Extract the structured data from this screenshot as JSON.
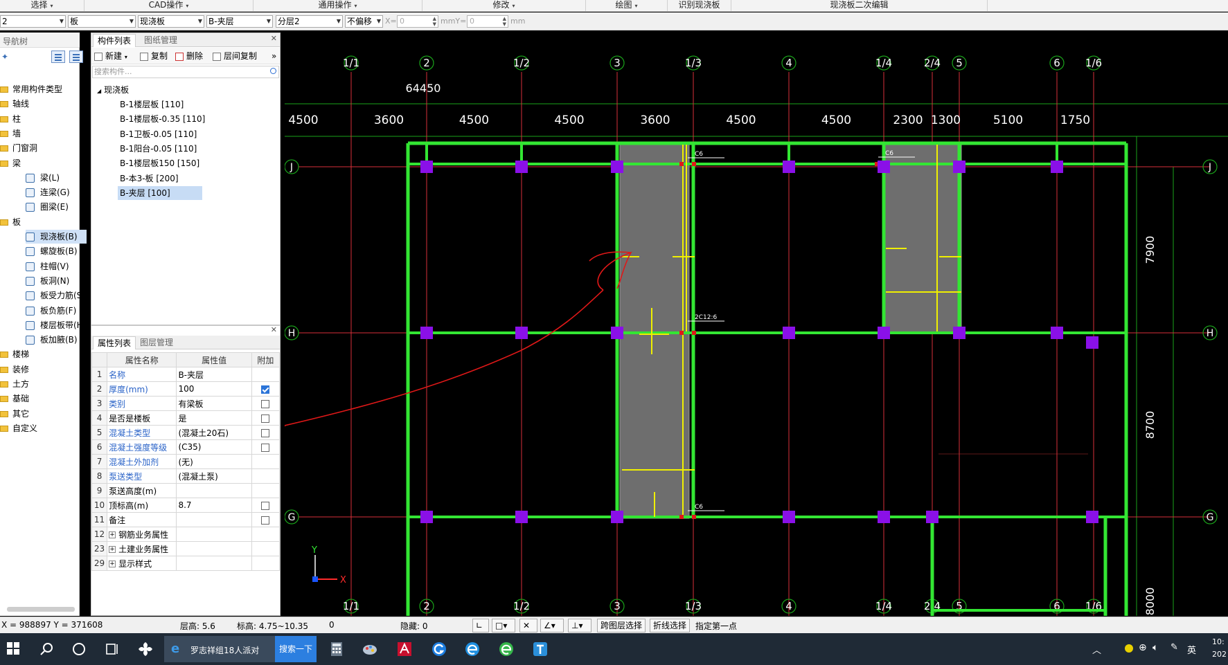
{
  "ribbon": {
    "groups": [
      {
        "label": "选择",
        "arrow": "▾"
      },
      {
        "label": "CAD操作",
        "arrow": "▾"
      },
      {
        "label": "通用操作",
        "arrow": "▾"
      },
      {
        "label": "修改",
        "arrow": "▾"
      },
      {
        "label": "绘图",
        "arrow": "▾"
      },
      {
        "label": "识别现浇板",
        "arrow": ""
      },
      {
        "label": "现浇板二次编辑",
        "arrow": ""
      }
    ]
  },
  "toolbar": {
    "floor": "2",
    "category": "板",
    "type": "现浇板",
    "component": "B-夹层",
    "layer": "分层2",
    "offset_mode": "不偏移",
    "x_label": "X=",
    "x_value": "0",
    "y_label": "mmY=",
    "y_value": "0",
    "unit": "mm"
  },
  "nav": {
    "title": "导航树",
    "items": [
      {
        "label": "常用构件类型",
        "level": 0
      },
      {
        "label": "轴线",
        "level": 0
      },
      {
        "label": "柱",
        "level": 0
      },
      {
        "label": "墙",
        "level": 0
      },
      {
        "label": "门窗洞",
        "level": 0
      },
      {
        "label": "梁",
        "level": 0
      },
      {
        "label": "梁(L)",
        "level": 1
      },
      {
        "label": "连梁(G)",
        "level": 1
      },
      {
        "label": "圈梁(E)",
        "level": 1
      },
      {
        "label": "板",
        "level": 0
      },
      {
        "label": "现浇板(B)",
        "level": 1,
        "selected": true
      },
      {
        "label": "螺旋板(B)",
        "level": 1
      },
      {
        "label": "柱帽(V)",
        "level": 1
      },
      {
        "label": "板洞(N)",
        "level": 1
      },
      {
        "label": "板受力筋(S)",
        "level": 1
      },
      {
        "label": "板负筋(F)",
        "level": 1
      },
      {
        "label": "楼层板带(H)",
        "level": 1
      },
      {
        "label": "板加腋(B)",
        "level": 1
      },
      {
        "label": "楼梯",
        "level": 0
      },
      {
        "label": "装修",
        "level": 0
      },
      {
        "label": "土方",
        "level": 0
      },
      {
        "label": "基础",
        "level": 0
      },
      {
        "label": "其它",
        "level": 0
      },
      {
        "label": "自定义",
        "level": 0
      }
    ]
  },
  "component_panel": {
    "tabs": [
      "构件列表",
      "图纸管理"
    ],
    "tools": [
      "新建",
      "复制",
      "删除",
      "层间复制"
    ],
    "more": "»",
    "search_placeholder": "搜索构件...",
    "group": "现浇板",
    "items": [
      {
        "label": "B-1楼层板 [110]"
      },
      {
        "label": "B-1楼层板-0.35 [110]"
      },
      {
        "label": "B-1卫板-0.05 [110]"
      },
      {
        "label": "B-1阳台-0.05 [110]"
      },
      {
        "label": "B-1楼层板150 [150]"
      },
      {
        "label": "B-本3-板 [200]"
      },
      {
        "label": "B-夹层 [100]",
        "selected": true
      }
    ]
  },
  "property_panel": {
    "tabs": [
      "属性列表",
      "图层管理"
    ],
    "headers": [
      "属性名称",
      "属性值",
      "附加"
    ],
    "rows": [
      {
        "no": "1",
        "name": "名称",
        "value": "B-夹层",
        "link": true,
        "check": "none"
      },
      {
        "no": "2",
        "name": "厚度(mm)",
        "value": "100",
        "link": true,
        "check": "on"
      },
      {
        "no": "3",
        "name": "类别",
        "value": "有梁板",
        "link": true,
        "check": "off"
      },
      {
        "no": "4",
        "name": "是否是楼板",
        "value": "是",
        "link": false,
        "check": "off"
      },
      {
        "no": "5",
        "name": "混凝土类型",
        "value": "(混凝土20石)",
        "link": true,
        "check": "off"
      },
      {
        "no": "6",
        "name": "混凝土强度等级",
        "value": "(C35)",
        "link": true,
        "check": "off"
      },
      {
        "no": "7",
        "name": "混凝土外加剂",
        "value": "(无)",
        "link": true,
        "check": "none"
      },
      {
        "no": "8",
        "name": "泵送类型",
        "value": "(混凝土泵)",
        "link": true,
        "check": "none"
      },
      {
        "no": "9",
        "name": "泵送高度(m)",
        "value": "",
        "link": false,
        "check": "none"
      },
      {
        "no": "10",
        "name": "顶标高(m)",
        "value": "8.7",
        "link": false,
        "check": "off"
      },
      {
        "no": "11",
        "name": "备注",
        "value": "",
        "link": false,
        "check": "off"
      },
      {
        "no": "12",
        "name": "钢筋业务属性",
        "value": "",
        "link": false,
        "check": "none",
        "expand": true
      },
      {
        "no": "23",
        "name": "土建业务属性",
        "value": "",
        "link": false,
        "check": "none",
        "expand": true
      },
      {
        "no": "29",
        "name": "显示样式",
        "value": "",
        "link": false,
        "check": "none",
        "expand": true
      }
    ]
  },
  "drawing": {
    "axes_x": [
      "1/1",
      "2",
      "1/2",
      "3",
      "1/3",
      "4",
      "1/4",
      "2/4",
      "5",
      "6",
      "1/6"
    ],
    "axes_y": [
      "J",
      "H",
      "G"
    ],
    "total_dim": "64450",
    "dims_x": [
      "4500",
      "3600",
      "4500",
      "4500",
      "3600",
      "4500",
      "4500",
      "2300",
      "1300",
      "5100",
      "1750"
    ],
    "dims_y": [
      "7900",
      "8700",
      "8000"
    ],
    "rebar_labels": [
      "C6",
      "C6",
      "2C12:6",
      "C6"
    ],
    "ucs_x": "X",
    "ucs_y": "Y",
    "colors": {
      "beam": "#33e633",
      "column": "#8a10e8",
      "axis": "#d8303a",
      "dim": "#1aa31a",
      "slab": "#6e6e6e",
      "rebar": "#f0f000",
      "annotation": "#e01818"
    }
  },
  "status": {
    "coords": "X = 988897 Y = 371608",
    "floor_height": "层高:  5.6",
    "elevation": "标高:  4.75~10.35",
    "count": "0",
    "hidden": "隐藏:  0",
    "btn_cross_layer": "跨图层选择",
    "btn_polyline": "折线选择",
    "hint": "指定第一点"
  },
  "taskbar": {
    "task_title": "罗志祥组18人派对",
    "search_button": "搜索一下",
    "ime": "英",
    "clock_line1": "10:",
    "clock_line2": "202"
  }
}
